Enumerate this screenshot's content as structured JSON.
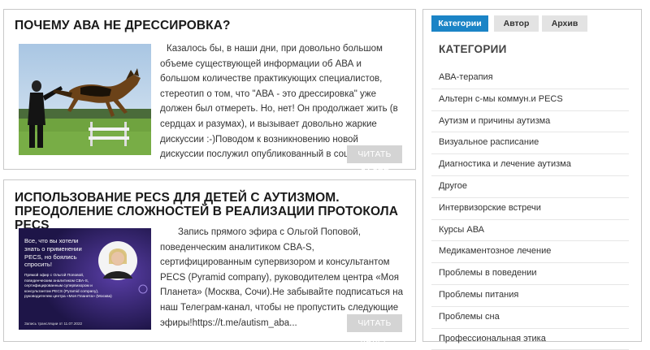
{
  "posts": [
    {
      "title": "ПОЧЕМУ АВА НЕ ДРЕССИРОВКА?",
      "excerpt": "Казалось бы, в наши дни, при довольно большом объеме существующей информации об АВА и большом количестве практикующих специалистов, стереотип о том, что \"АВА - это дрессировка\" уже должен был отмереть. Но, нет! Он продолжает жить (в сердцах и разумах), и вызывает довольно жаркие дискуссии :-)Поводом к возникновению новой дискуссии послужил опубликованный в соцсетях...",
      "read_more": "ЧИТАТЬ ДАЛЕЕ"
    },
    {
      "title": "ИСПОЛЬЗОВАНИЕ PECS ДЛЯ ДЕТЕЙ С АУТИЗМОМ. ПРЕОДОЛЕНИЕ СЛОЖНОСТЕЙ В РЕАЛИЗАЦИИ ПРОТОКОЛА PECS",
      "excerpt": "Запись прямого эфира с Ольгой Поповой, поведенческим аналитиком CBA-S, сертифицированным супервизором и консультантом PECS (Pyramid company), руководителем центра «Моя Планета» (Москва, Сочи).Не забывайте подписаться на наш Телеграм-канал, чтобы не пропустить следующие эфиры!https://t.me/autism_aba...",
      "read_more": "ЧИТАТЬ ДАЛЕЕ",
      "thumb": {
        "heading": "Все, что вы хотели знать о применении PECS, но боялись спросить!",
        "body": "Прямой эфир с Ольгой Поповой, поведенческим аналитиком CBA-S, сертифицированным супервизором и консультантом PECS (Pyramid company), руководителем центра «Моя Планета» (Москва)",
        "footer": "Запись трансляции от 11.07.2022"
      }
    }
  ],
  "sidebar": {
    "tabs": [
      "Категории",
      "Автор",
      "Архив"
    ],
    "active_tab": "Категории",
    "title": "КАТЕГОРИИ",
    "categories": [
      "АВА-терапия",
      "Альтерн с-мы коммун.и PECS",
      "Аутизм и причины аутизма",
      "Визуальное расписание",
      "Диагностика и лечение аутизма",
      "Другое",
      "Интервизорские встречи",
      "Курсы АВА",
      "Медикаментозное лечение",
      "Проблемы в поведении",
      "Проблемы питания",
      "Проблемы сна",
      "Профессиональная этика"
    ]
  },
  "colors": {
    "accent": "#1b84c6",
    "tab_inactive": "#e3e3e3",
    "button": "#d4d4d4",
    "thumb_bg": "#2a1f5c"
  },
  "icons": [
    "dog-photo",
    "webinar-banner"
  ]
}
